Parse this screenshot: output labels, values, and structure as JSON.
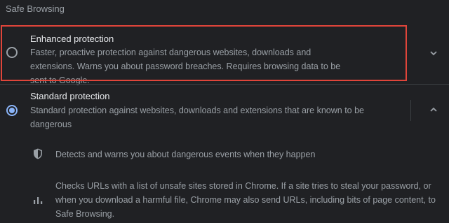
{
  "section": {
    "title": "Safe Browsing"
  },
  "enhanced": {
    "title": "Enhanced protection",
    "description": "Faster, proactive protection against dangerous websites, downloads and extensions. Warns you about password breaches. Requires browsing data to be sent to Google.",
    "selected": false,
    "expand_icon": "chevron-down-icon"
  },
  "standard": {
    "title": "Standard protection",
    "description": "Standard protection against websites, downloads and extensions that are known to be dangerous",
    "selected": true,
    "expand_icon": "chevron-up-icon",
    "details": [
      {
        "icon": "shield-icon",
        "text": "Detects and warns you about dangerous events when they happen"
      },
      {
        "icon": "bar-chart-icon",
        "text": "Checks URLs with a list of unsafe sites stored in Chrome. If a site tries to steal your password, or when you download a harmful file, Chrome may also send URLs, including bits of page content, to Safe Browsing."
      }
    ]
  },
  "colors": {
    "accent": "#8ab4f8",
    "highlight": "#e0453a",
    "background": "#202124"
  }
}
